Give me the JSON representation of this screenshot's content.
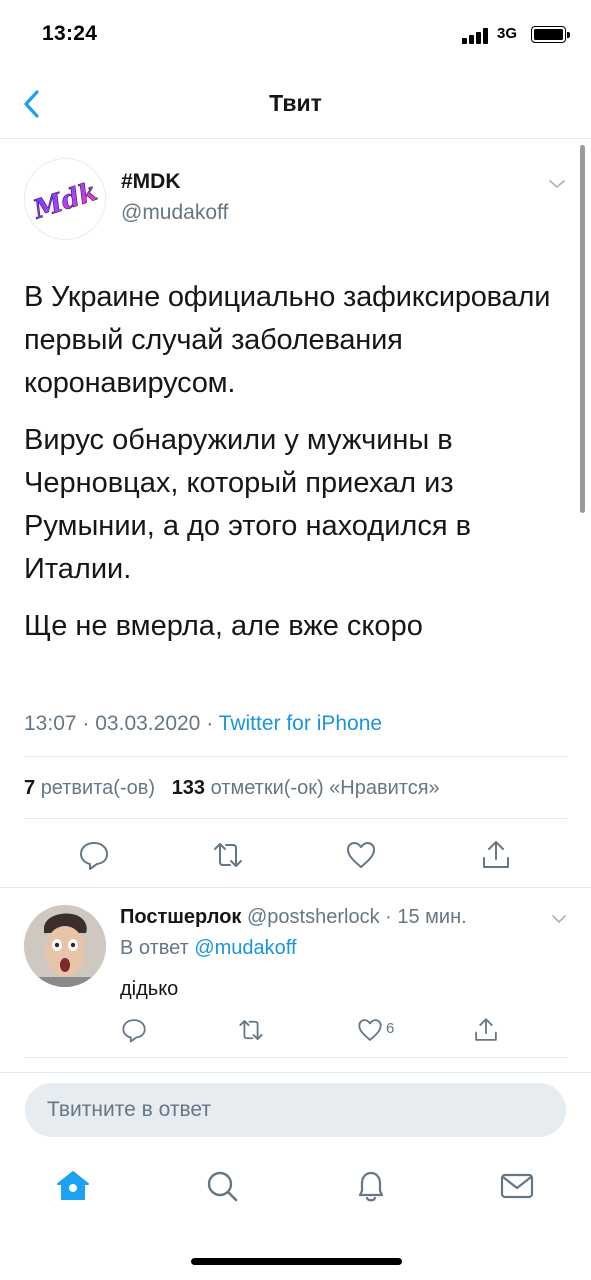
{
  "status_bar": {
    "time": "13:24",
    "network": "3G",
    "icons": [
      "signal-icon",
      "battery-icon"
    ]
  },
  "nav": {
    "title": "Твит",
    "back_icon": "chevron-left-icon"
  },
  "tweet": {
    "author_name": "#MDK",
    "author_handle": "@mudakoff",
    "avatar_text": "Mdk",
    "paragraphs": [
      "В Украине официально зафиксировали первый случай заболевания коронавирусом.",
      "Вирус обнаружили у мужчины в Черновцах, который приехал из Румынии, а до этого находился в Италии.",
      "Ще не вмерла, але вже скоро"
    ],
    "time": "13:07",
    "date": "03.03.2020",
    "separator": "·",
    "source": "Twitter for iPhone",
    "retweets_count": "7",
    "retweets_label": "ретвита(-ов)",
    "likes_count": "133",
    "likes_label": "отметки(-ок) «Нравится»",
    "actions": [
      "reply-icon",
      "retweet-icon",
      "like-icon",
      "share-icon"
    ]
  },
  "reply": {
    "author_name": "Постшерлок",
    "author_handle": "@postsherlock",
    "separator": "·",
    "time_ago": "15 мин.",
    "in_reply_to_label": "В ответ",
    "in_reply_to_handle": "@mudakoff",
    "text": "дідько",
    "like_count": "6"
  },
  "compose": {
    "placeholder": "Твитните в ответ"
  },
  "tab_bar": {
    "tabs": [
      "home-icon",
      "search-icon",
      "notifications-icon",
      "messages-icon"
    ],
    "active_color": "#1da1f2",
    "inactive_color": "#657786"
  },
  "colors": {
    "accent": "#1da1f2",
    "link": "#1b95e0",
    "text": "#14171a",
    "secondary": "#657786",
    "divider": "#e1e8ed"
  }
}
